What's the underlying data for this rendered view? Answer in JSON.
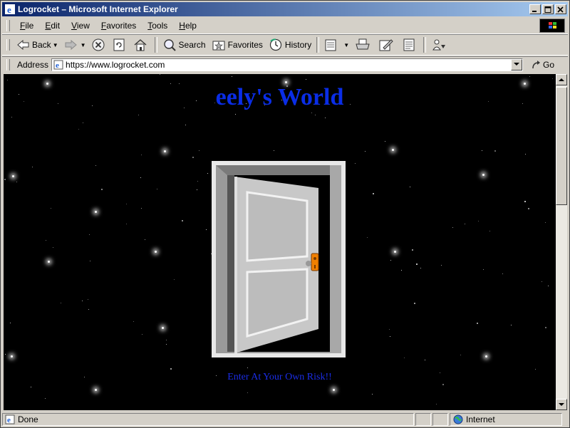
{
  "window": {
    "title": "Logrocket – Microsoft Internet Explorer"
  },
  "menu": {
    "items": [
      {
        "key": "F",
        "rest": "ile"
      },
      {
        "key": "E",
        "rest": "dit"
      },
      {
        "key": "V",
        "rest": "iew"
      },
      {
        "key": "F",
        "rest": "avorites"
      },
      {
        "key": "T",
        "rest": "ools"
      },
      {
        "key": "H",
        "rest": "elp"
      }
    ]
  },
  "toolbar": {
    "back": "Back",
    "search": "Search",
    "favorites": "Favorites",
    "history": "History"
  },
  "address": {
    "label": "Address",
    "url": "https://www.logrocket.com",
    "go": "Go"
  },
  "page": {
    "headline": "eely's World",
    "link": "Enter At Your Own Risk!!"
  },
  "status": {
    "text": "Done",
    "zone": "Internet"
  },
  "colors": {
    "headline": "#0a2de6",
    "background": "#000000",
    "doorknob": "#f08000"
  }
}
